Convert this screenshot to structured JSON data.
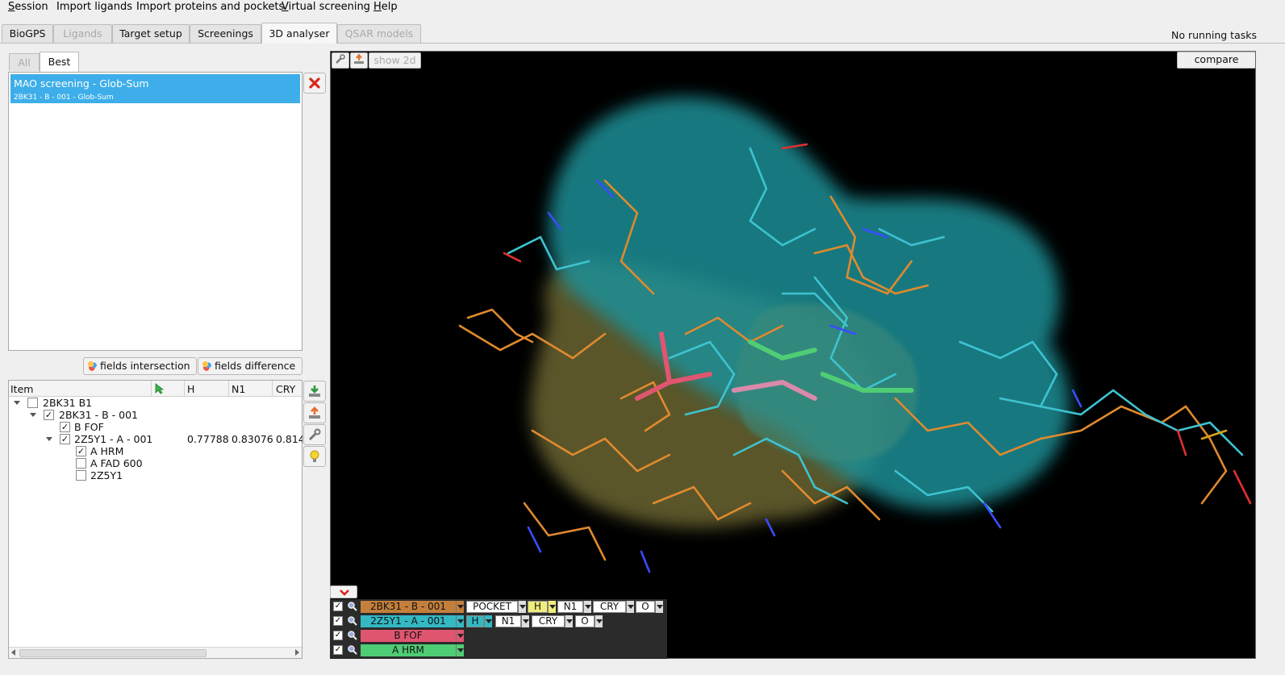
{
  "menu": [
    {
      "label": "Session",
      "mnemonic": "S",
      "rest": "ession"
    },
    {
      "label": "Import ligands",
      "mnemonic": "",
      "rest": "Import ligands"
    },
    {
      "label": "Import proteins and pockets",
      "mnemonic": "",
      "rest": "Import proteins and pockets"
    },
    {
      "label": "Virtual screening",
      "mnemonic": "V",
      "rest": "irtual screening"
    },
    {
      "label": "Help",
      "mnemonic": "H",
      "rest": "elp"
    }
  ],
  "tabs": [
    "BioGPS",
    "Ligands",
    "Target setup",
    "Screenings",
    "3D analyser",
    "QSAR models"
  ],
  "status": "No running tasks",
  "subtabs": {
    "all": "All",
    "best": "Best"
  },
  "results": {
    "title": "MAO screening - Glob-Sum",
    "subtitle": "2BK31 - B - 001 - Glob-Sum"
  },
  "buttons": {
    "fields_intersection": "fields intersection",
    "fields_difference": "fields difference",
    "show2d": "show 2d",
    "compare": "compare"
  },
  "tree": {
    "headers": [
      "Item",
      "H",
      "N1",
      "CRY"
    ],
    "rows": [
      {
        "label": "2BK31 B1",
        "checked": false
      },
      {
        "label": "2BK31 - B - 001",
        "checked": true
      },
      {
        "label": "B FOF",
        "checked": true
      },
      {
        "label": "2Z5Y1 - A - 001",
        "checked": true,
        "h": "0.77788",
        "n1": "0.83076",
        "cry": "0.814"
      },
      {
        "label": "A HRM",
        "checked": true
      },
      {
        "label": "A FAD 600",
        "checked": false
      },
      {
        "label": "2Z5Y1",
        "checked": false
      }
    ]
  },
  "legend": {
    "rows": [
      {
        "name": "2BK31 - B - 001",
        "color": "#c47f3c",
        "fields": [
          "POCKET",
          "H",
          "N1",
          "CRY",
          "O"
        ]
      },
      {
        "name": "2Z5Y1 - A - 001",
        "color": "#33b8c4",
        "fields": [
          "H",
          "N1",
          "CRY",
          "O"
        ]
      },
      {
        "name": "B FOF",
        "color": "#e0556f",
        "fields": []
      },
      {
        "name": "A HRM",
        "color": "#4fcd74",
        "fields": []
      }
    ]
  },
  "colors": {
    "selection": "#3daee9",
    "viewer_bg": "#000000",
    "cavity_cyan": "#1f8f96",
    "cavity_olive": "#6b6530"
  }
}
